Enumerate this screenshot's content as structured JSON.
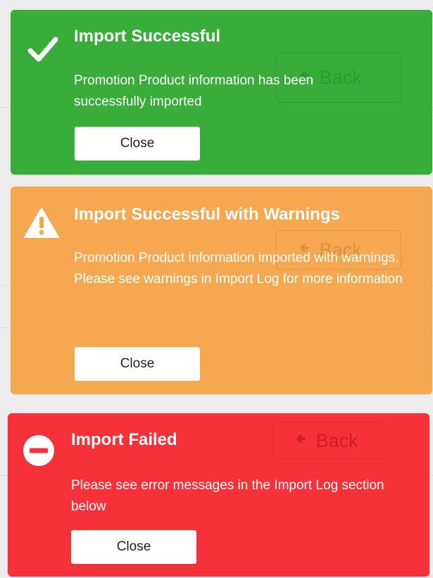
{
  "background": {
    "back_label": "Back"
  },
  "toasts": {
    "success": {
      "title": "Import Successful",
      "message": "Promotion Product information has been successfully imported",
      "close_label": "Close",
      "color": "#38ad3a",
      "icon": "checkmark-icon"
    },
    "warning": {
      "title": "Import Successful with Warnings",
      "message_line1": "Promotion Product information imported with warnings.",
      "message_line2": "Please see warnings in Import Log for more information",
      "close_label": "Close",
      "color": "#f5a84f",
      "icon": "warning-triangle-icon"
    },
    "error": {
      "title": "Import Failed",
      "message": "Please see error messages in the Import Log section below",
      "close_label": "Close",
      "color": "#f7313a",
      "icon": "no-entry-icon"
    }
  }
}
